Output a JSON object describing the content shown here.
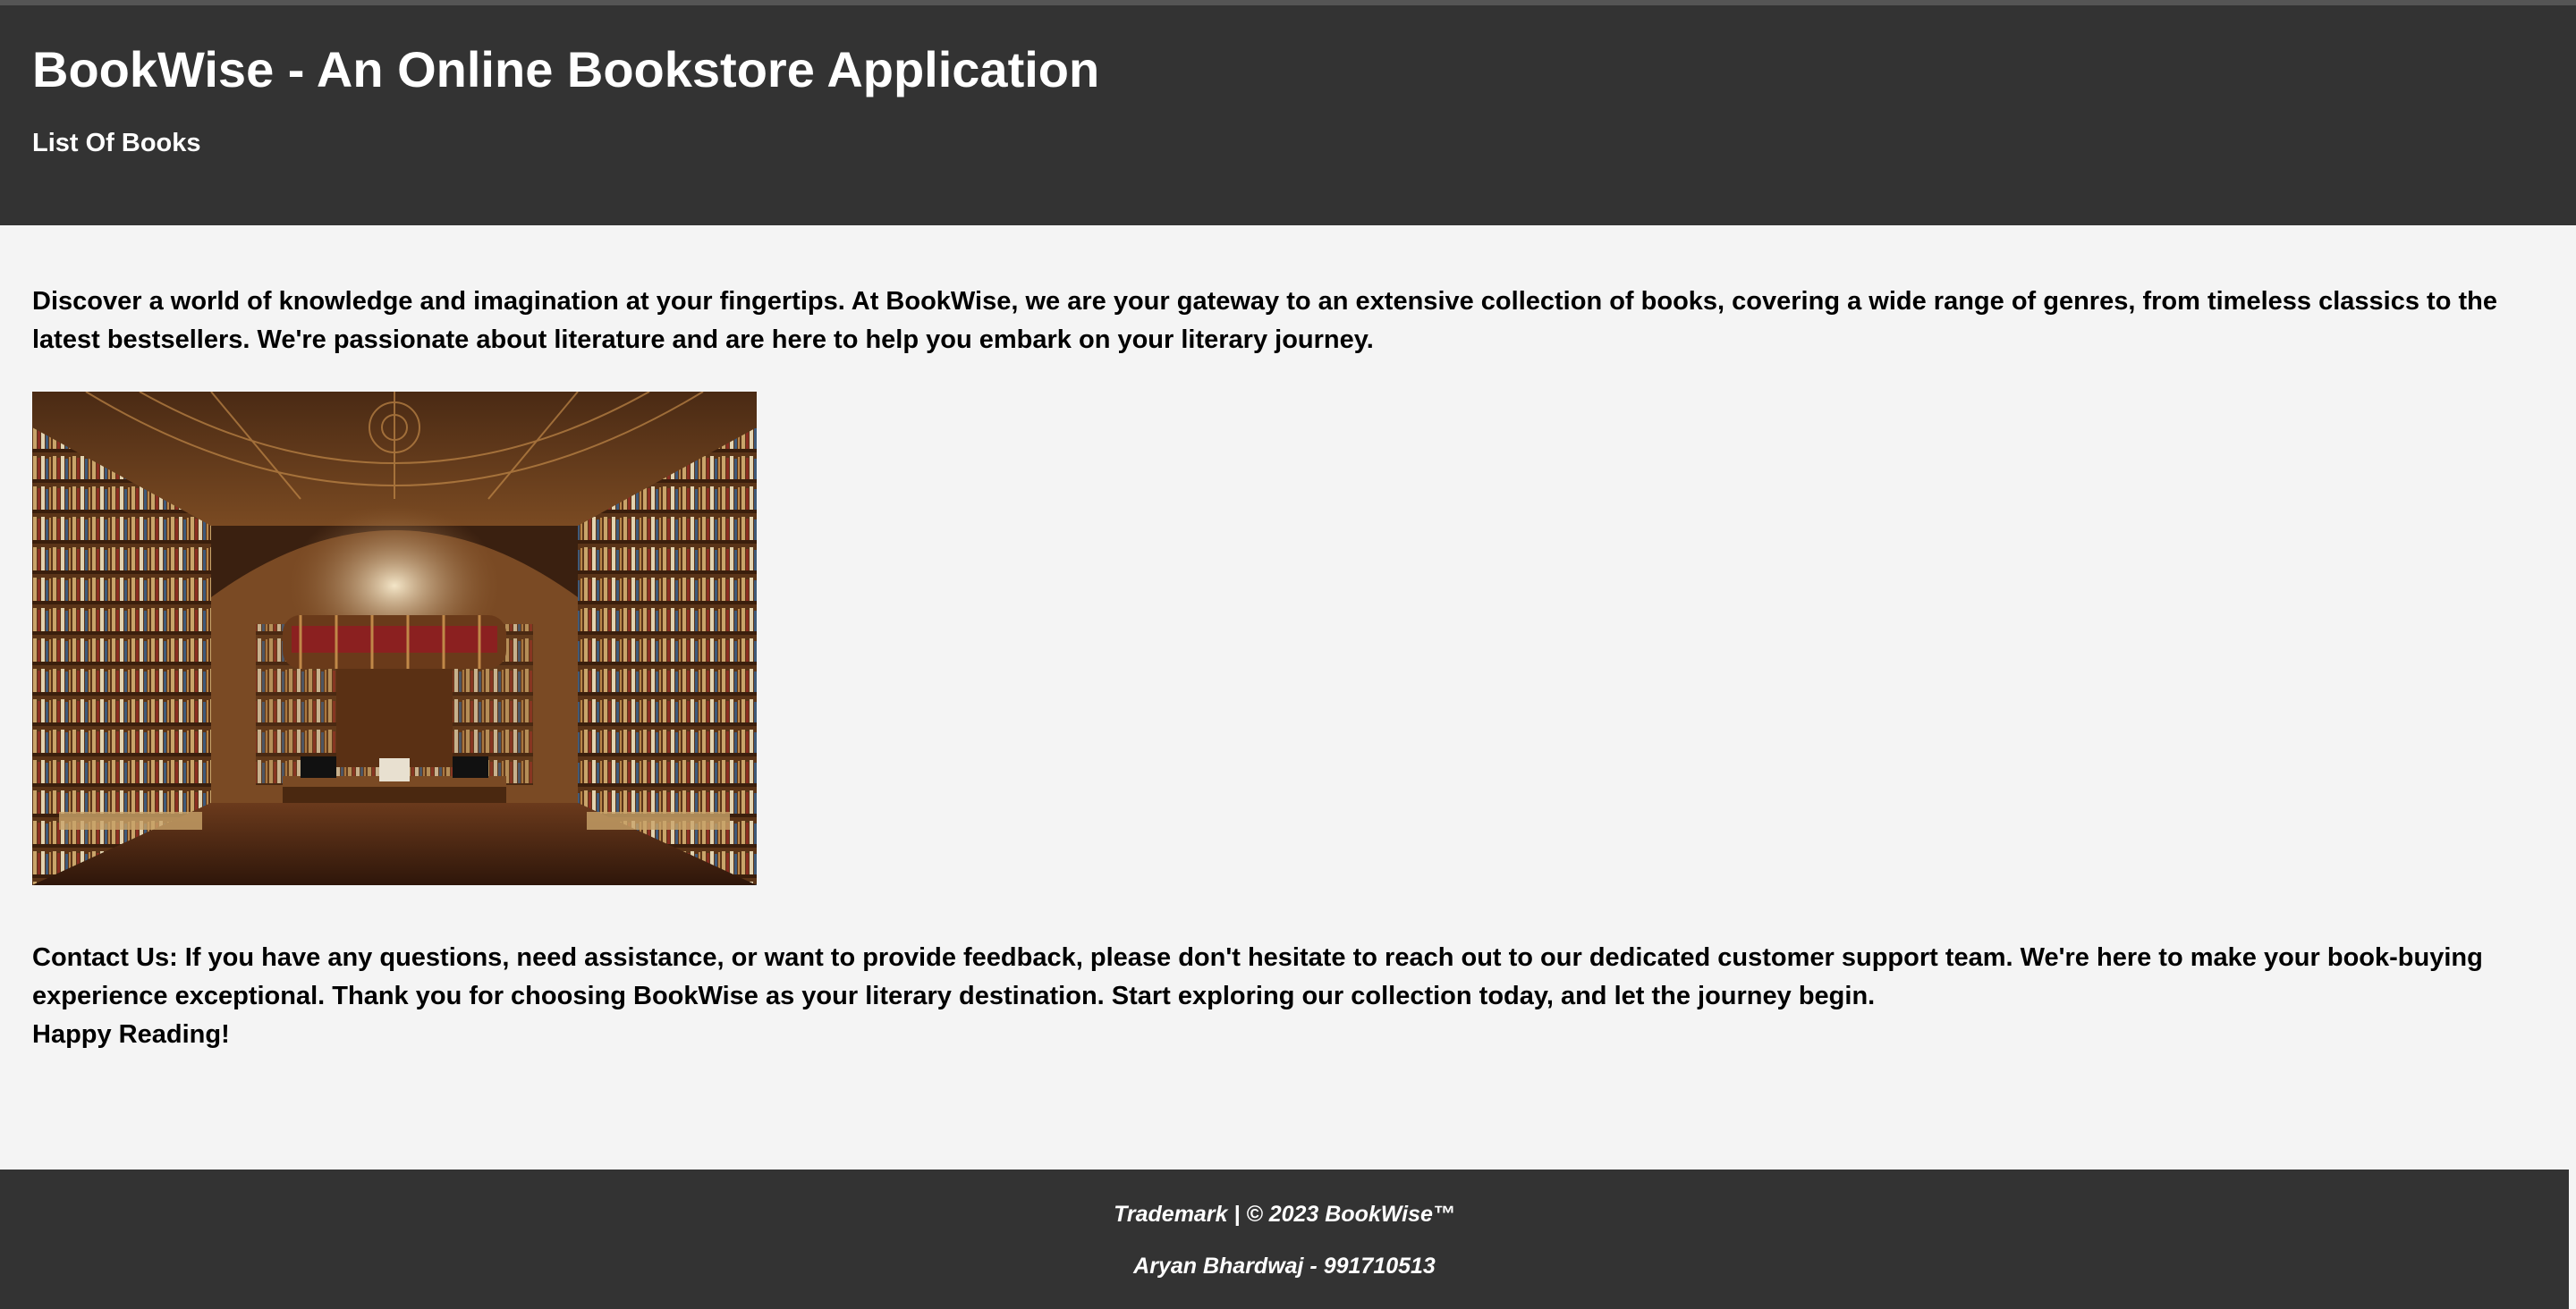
{
  "header": {
    "title": "BookWise - An Online Bookstore Application",
    "nav_link": "List Of Books"
  },
  "main": {
    "intro": "Discover a world of knowledge and imagination at your fingertips. At BookWise, we are your gateway to an extensive collection of books, covering a wide range of genres, from timeless classics to the latest bestsellers. We're passionate about literature and are here to help you embark on your literary journey.",
    "contact": "Contact Us: If you have any questions, need assistance, or want to provide feedback, please don't hesitate to reach out to our dedicated customer support team. We're here to make your book-buying experience exceptional. Thank you for choosing BookWise as your literary destination. Start exploring our collection today, and let the journey begin.",
    "closing": "Happy Reading!"
  },
  "footer": {
    "trademark": "Trademark | © 2023 BookWise™",
    "author": "Aryan Bhardwaj - 991710513"
  },
  "colors": {
    "header_bg": "#333333",
    "page_bg": "#f4f4f4",
    "text": "#000000"
  }
}
